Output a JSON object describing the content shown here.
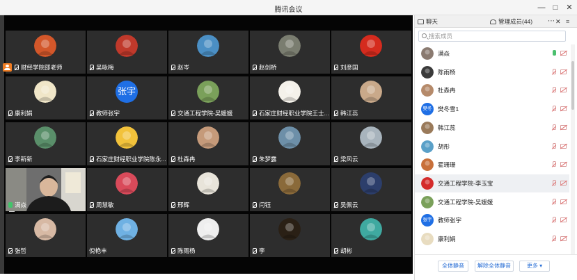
{
  "window": {
    "title": "腾讯会议",
    "controls": [
      "—",
      "□",
      "✕"
    ]
  },
  "tiles": [
    {
      "name": "财经学院邵老师",
      "mic": "muted",
      "host": true,
      "avatar_color": "#d3572a",
      "avatar_kind": "tiger-cartoon"
    },
    {
      "name": "吴咏梅",
      "mic": "muted",
      "avatar_color": "#c0392b",
      "avatar_kind": "red-decor"
    },
    {
      "name": "赵岑",
      "mic": "muted",
      "avatar_color": "#4b8fc4",
      "avatar_kind": "person-photo"
    },
    {
      "name": "赵剑桥",
      "mic": "muted",
      "avatar_color": "#7a7d70",
      "avatar_kind": "street-photo"
    },
    {
      "name": "刘彦国",
      "mic": "muted",
      "avatar_color": "#d52b1e",
      "avatar_kind": "flag"
    },
    {
      "name": "康利娟",
      "mic": "muted",
      "avatar_color": "#f0e6c8",
      "avatar_kind": "cat-cartoon"
    },
    {
      "name": "教师张宇",
      "mic": "muted",
      "avatar_color": "#1f6fe5",
      "avatar_text": "张宇"
    },
    {
      "name": "交通工程学院-吴媛媛",
      "mic": "muted",
      "avatar_color": "#7aa05a",
      "avatar_kind": "plant-photo"
    },
    {
      "name": "石家庄财经职业学院王士...",
      "mic": "muted",
      "avatar_color": "#f4f1ea",
      "avatar_kind": "stamp"
    },
    {
      "name": "韩江蕊",
      "mic": "muted",
      "avatar_color": "#c9a98a",
      "avatar_kind": "person-photo"
    },
    {
      "name": "李新新",
      "mic": "muted",
      "avatar_color": "#5a8f6a",
      "avatar_kind": "landscape-photo"
    },
    {
      "name": "石家庄财经职业学院陈永...",
      "mic": "muted",
      "avatar_color": "#f2c23b",
      "avatar_kind": "person-photo"
    },
    {
      "name": "杜森冉",
      "mic": "muted",
      "avatar_color": "#c59a7a",
      "avatar_kind": "person-photo"
    },
    {
      "name": "朱梦露",
      "mic": "muted",
      "avatar_color": "#6d8fa8",
      "avatar_kind": "landscape-photo"
    },
    {
      "name": "梁风云",
      "mic": "muted",
      "avatar_color": "#a8b4bd",
      "avatar_kind": "landscape-photo"
    },
    {
      "name": "满焱",
      "mic": "on",
      "video": true
    },
    {
      "name": "周慧敏",
      "mic": "muted",
      "avatar_color": "#d94a5a",
      "avatar_kind": "landscape-photo"
    },
    {
      "name": "邢辉",
      "mic": "muted",
      "avatar_color": "#e8e4da",
      "avatar_kind": "person-photo"
    },
    {
      "name": "闫钰",
      "mic": "muted",
      "avatar_color": "#8a6a3a",
      "avatar_kind": "person-photo"
    },
    {
      "name": "吴佩云",
      "mic": "muted",
      "avatar_color": "#2c3e6b",
      "avatar_kind": "night-photo"
    },
    {
      "name": "张哲",
      "mic": "muted",
      "avatar_color": "#d7b9a4",
      "avatar_kind": "person-photo"
    },
    {
      "name": "倪艳丰",
      "mic": "none",
      "avatar_color": "#6fb1e3",
      "avatar_kind": "sky-photo"
    },
    {
      "name": "陈雨杨",
      "mic": "muted",
      "avatar_color": "#eeeeee",
      "avatar_kind": "person-photo"
    },
    {
      "name": "李",
      "mic": "muted",
      "avatar_color": "#2a2015",
      "avatar_kind": "night-photo"
    },
    {
      "name": "胡彬",
      "mic": "muted",
      "avatar_color": "#3fa9a0",
      "avatar_kind": "cartoon"
    }
  ],
  "sidebar": {
    "chat_tab": "聊天",
    "members_tab": "管理成员(44)",
    "more_icon": "⋯",
    "close_icon": "✕",
    "menu_icon": "≡",
    "search_placeholder": "搜索成员",
    "members": [
      {
        "name": "满焱",
        "mic": "on",
        "avatar_color": "#8a7a70"
      },
      {
        "name": "陈雨杨",
        "mic": "muted",
        "avatar_color": "#3a3a3a"
      },
      {
        "name": "杜森冉",
        "mic": "muted",
        "avatar_color": "#b58a6a"
      },
      {
        "name": "樊冬雪1",
        "mic": "muted",
        "avatar_color": "#1f6fe5",
        "avatar_text": "樊冬"
      },
      {
        "name": "韩江蕊",
        "mic": "muted",
        "avatar_color": "#9a7a5a"
      },
      {
        "name": "胡彤",
        "mic": "muted",
        "avatar_color": "#5aa0c8"
      },
      {
        "name": "霍珊珊",
        "mic": "muted",
        "avatar_color": "#c8703a"
      },
      {
        "name": "交通工程学院-李玉宝",
        "mic": "muted",
        "avatar_color": "#d42a2a",
        "selected": true
      },
      {
        "name": "交通工程学院-吴媛媛",
        "mic": "muted",
        "avatar_color": "#7aa05a"
      },
      {
        "name": "教师张宇",
        "mic": "muted",
        "avatar_color": "#1f6fe5",
        "avatar_text": "张宇"
      },
      {
        "name": "康利娟",
        "mic": "muted",
        "avatar_color": "#e8dcc0"
      }
    ],
    "footer": {
      "mute_all": "全体静音",
      "unmute_all": "解除全体静音",
      "more": "更多 ▾"
    }
  }
}
